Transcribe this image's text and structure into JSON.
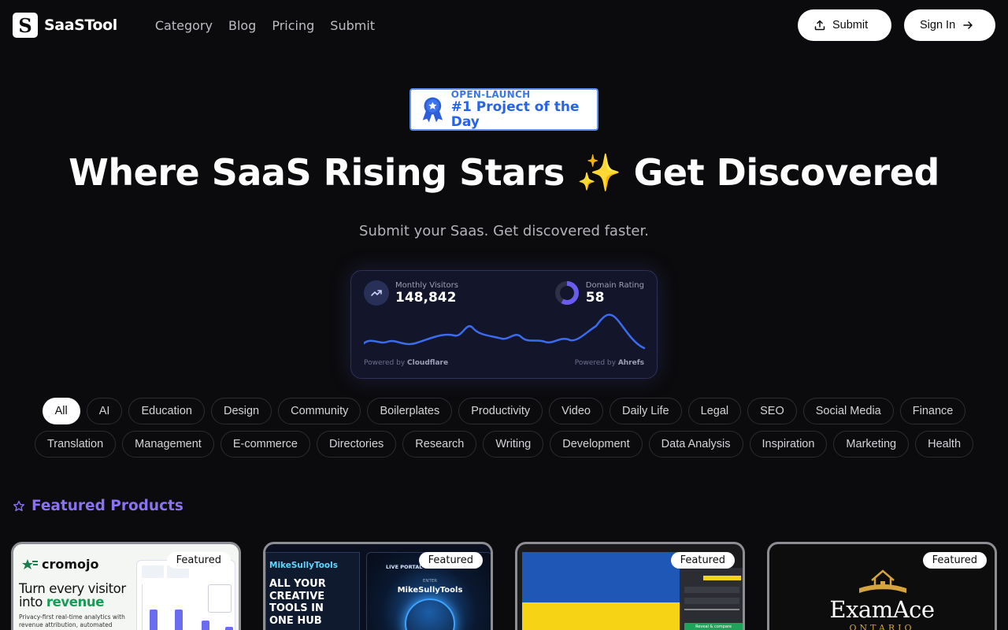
{
  "header": {
    "logo_letter": "S",
    "brand": "SaaSTool",
    "nav": [
      "Category",
      "Blog",
      "Pricing",
      "Submit"
    ],
    "submit_label": "Submit",
    "signin_label": "Sign In"
  },
  "badge": {
    "top": "OPEN-LAUNCH",
    "main": "#1 Project of the Day"
  },
  "hero": {
    "title_part1": "Where SaaS Rising Stars",
    "sparkle": "✨",
    "title_part2": "Get Discovered",
    "subtitle": "Submit your Saas. Get discovered faster."
  },
  "stats": {
    "visitors_label": "Monthly Visitors",
    "visitors_value": "148,842",
    "rating_label": "Domain Rating",
    "rating_value": "58",
    "rating_fraction": 0.58,
    "powered_left_prefix": "Powered by",
    "powered_left_brand": "Cloudflare",
    "powered_right_prefix": "Powered by",
    "powered_right_brand": "Ahrefs",
    "accent_color": "#3b6cf0"
  },
  "categories": {
    "row1": [
      "All",
      "AI",
      "Education",
      "Design",
      "Community",
      "Boilerplates",
      "Productivity",
      "Video",
      "Daily Life",
      "Legal",
      "SEO",
      "Social Media",
      "Finance"
    ],
    "row2": [
      "Translation",
      "Management",
      "E-commerce",
      "Directories",
      "Research",
      "Writing",
      "Development",
      "Data Analysis",
      "Inspiration",
      "Marketing",
      "Health"
    ],
    "active": "All"
  },
  "featured": {
    "heading": "Featured Products",
    "tag_label": "Featured",
    "cards": [
      {
        "brand": "cromojo",
        "headline_line1": "Turn every visitor",
        "headline_line2_prefix": "into",
        "headline_line2_accent": "revenue",
        "body": "Privacy-first real-time analytics with revenue attribution, automated indexing, and website monitoring."
      },
      {
        "brand": "MikeSullyTools",
        "headline": "ALL YOUR CREATIVE TOOLS IN ONE HUB",
        "portal_label": "LIVE PORTAL",
        "portal_enter": "ENTER",
        "portal_title": "MikeSullyTools"
      },
      {
        "panel_button": "Reveal & compare"
      },
      {
        "title": "ExamAce",
        "subtitle": "ONTARIO"
      }
    ]
  }
}
